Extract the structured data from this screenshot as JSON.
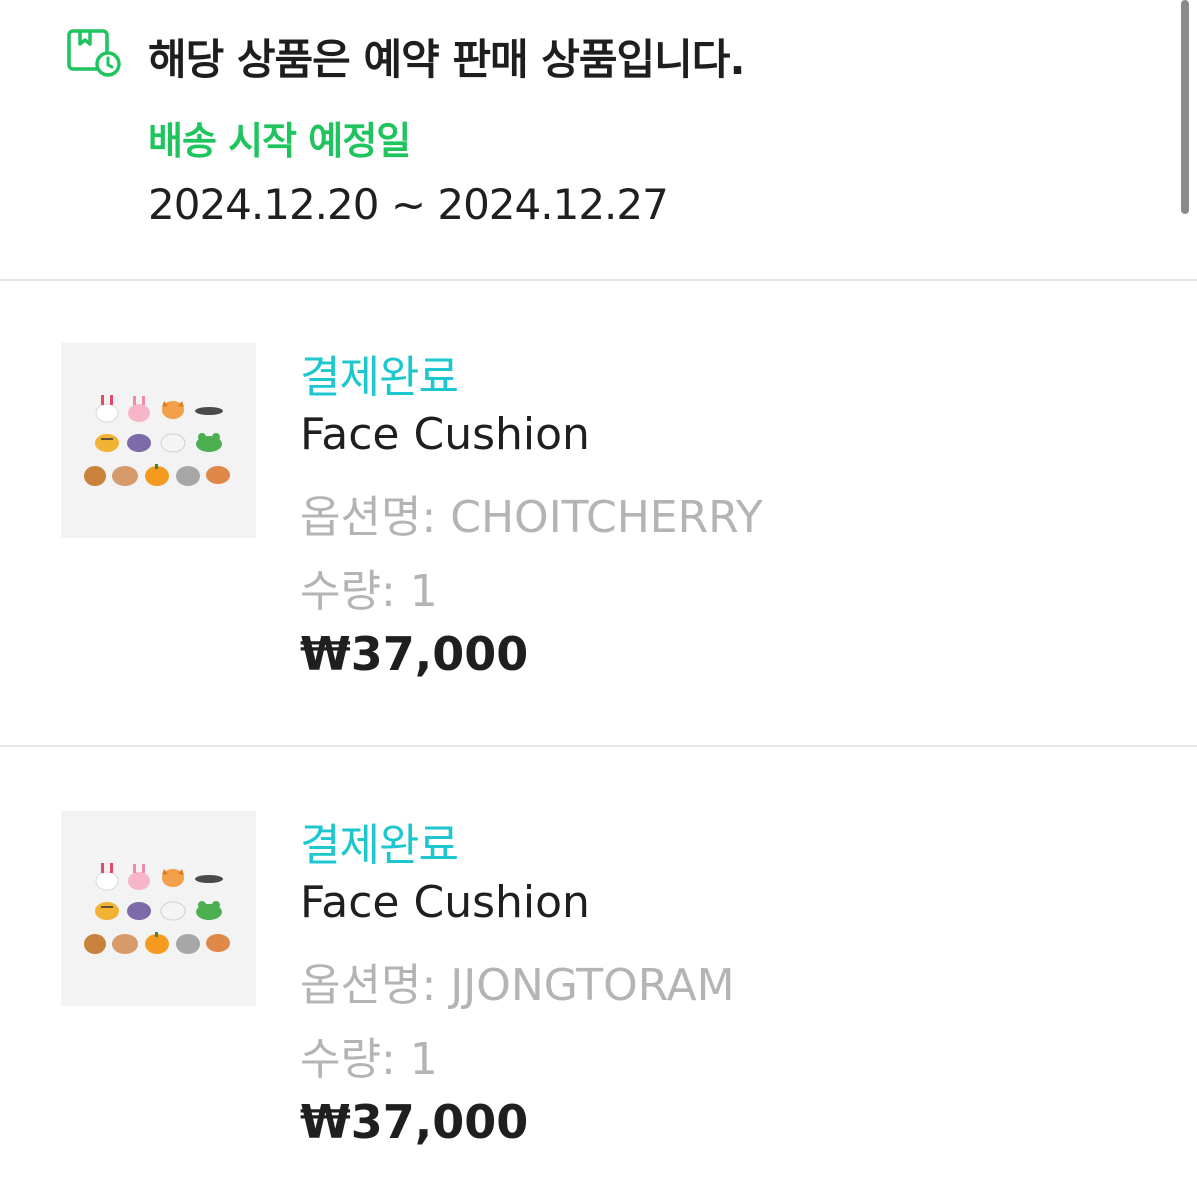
{
  "notice": {
    "icon": "preorder-calendar-clock-icon",
    "title": "해당 상품은 예약 판매 상품입니다.",
    "shipping_label": "배송 시작 예정일",
    "shipping_range": "2024.12.20 ~ 2024.12.27"
  },
  "items": [
    {
      "thumbnail_icon": "face-cushion-thumbnail",
      "status": "결제완료",
      "name": "Face Cushion",
      "option": "옵션명: CHOITCHERRY",
      "quantity": "수량: 1",
      "price": "₩37,000"
    },
    {
      "thumbnail_icon": "face-cushion-thumbnail",
      "status": "결제완료",
      "name": "Face Cushion",
      "option": "옵션명: JJONGTORAM",
      "quantity": "수량: 1",
      "price": "₩37,000"
    }
  ],
  "colors": {
    "accent_green": "#1fc45e",
    "status_cyan": "#1cc7cf",
    "muted_gray": "#b4b4b4"
  }
}
